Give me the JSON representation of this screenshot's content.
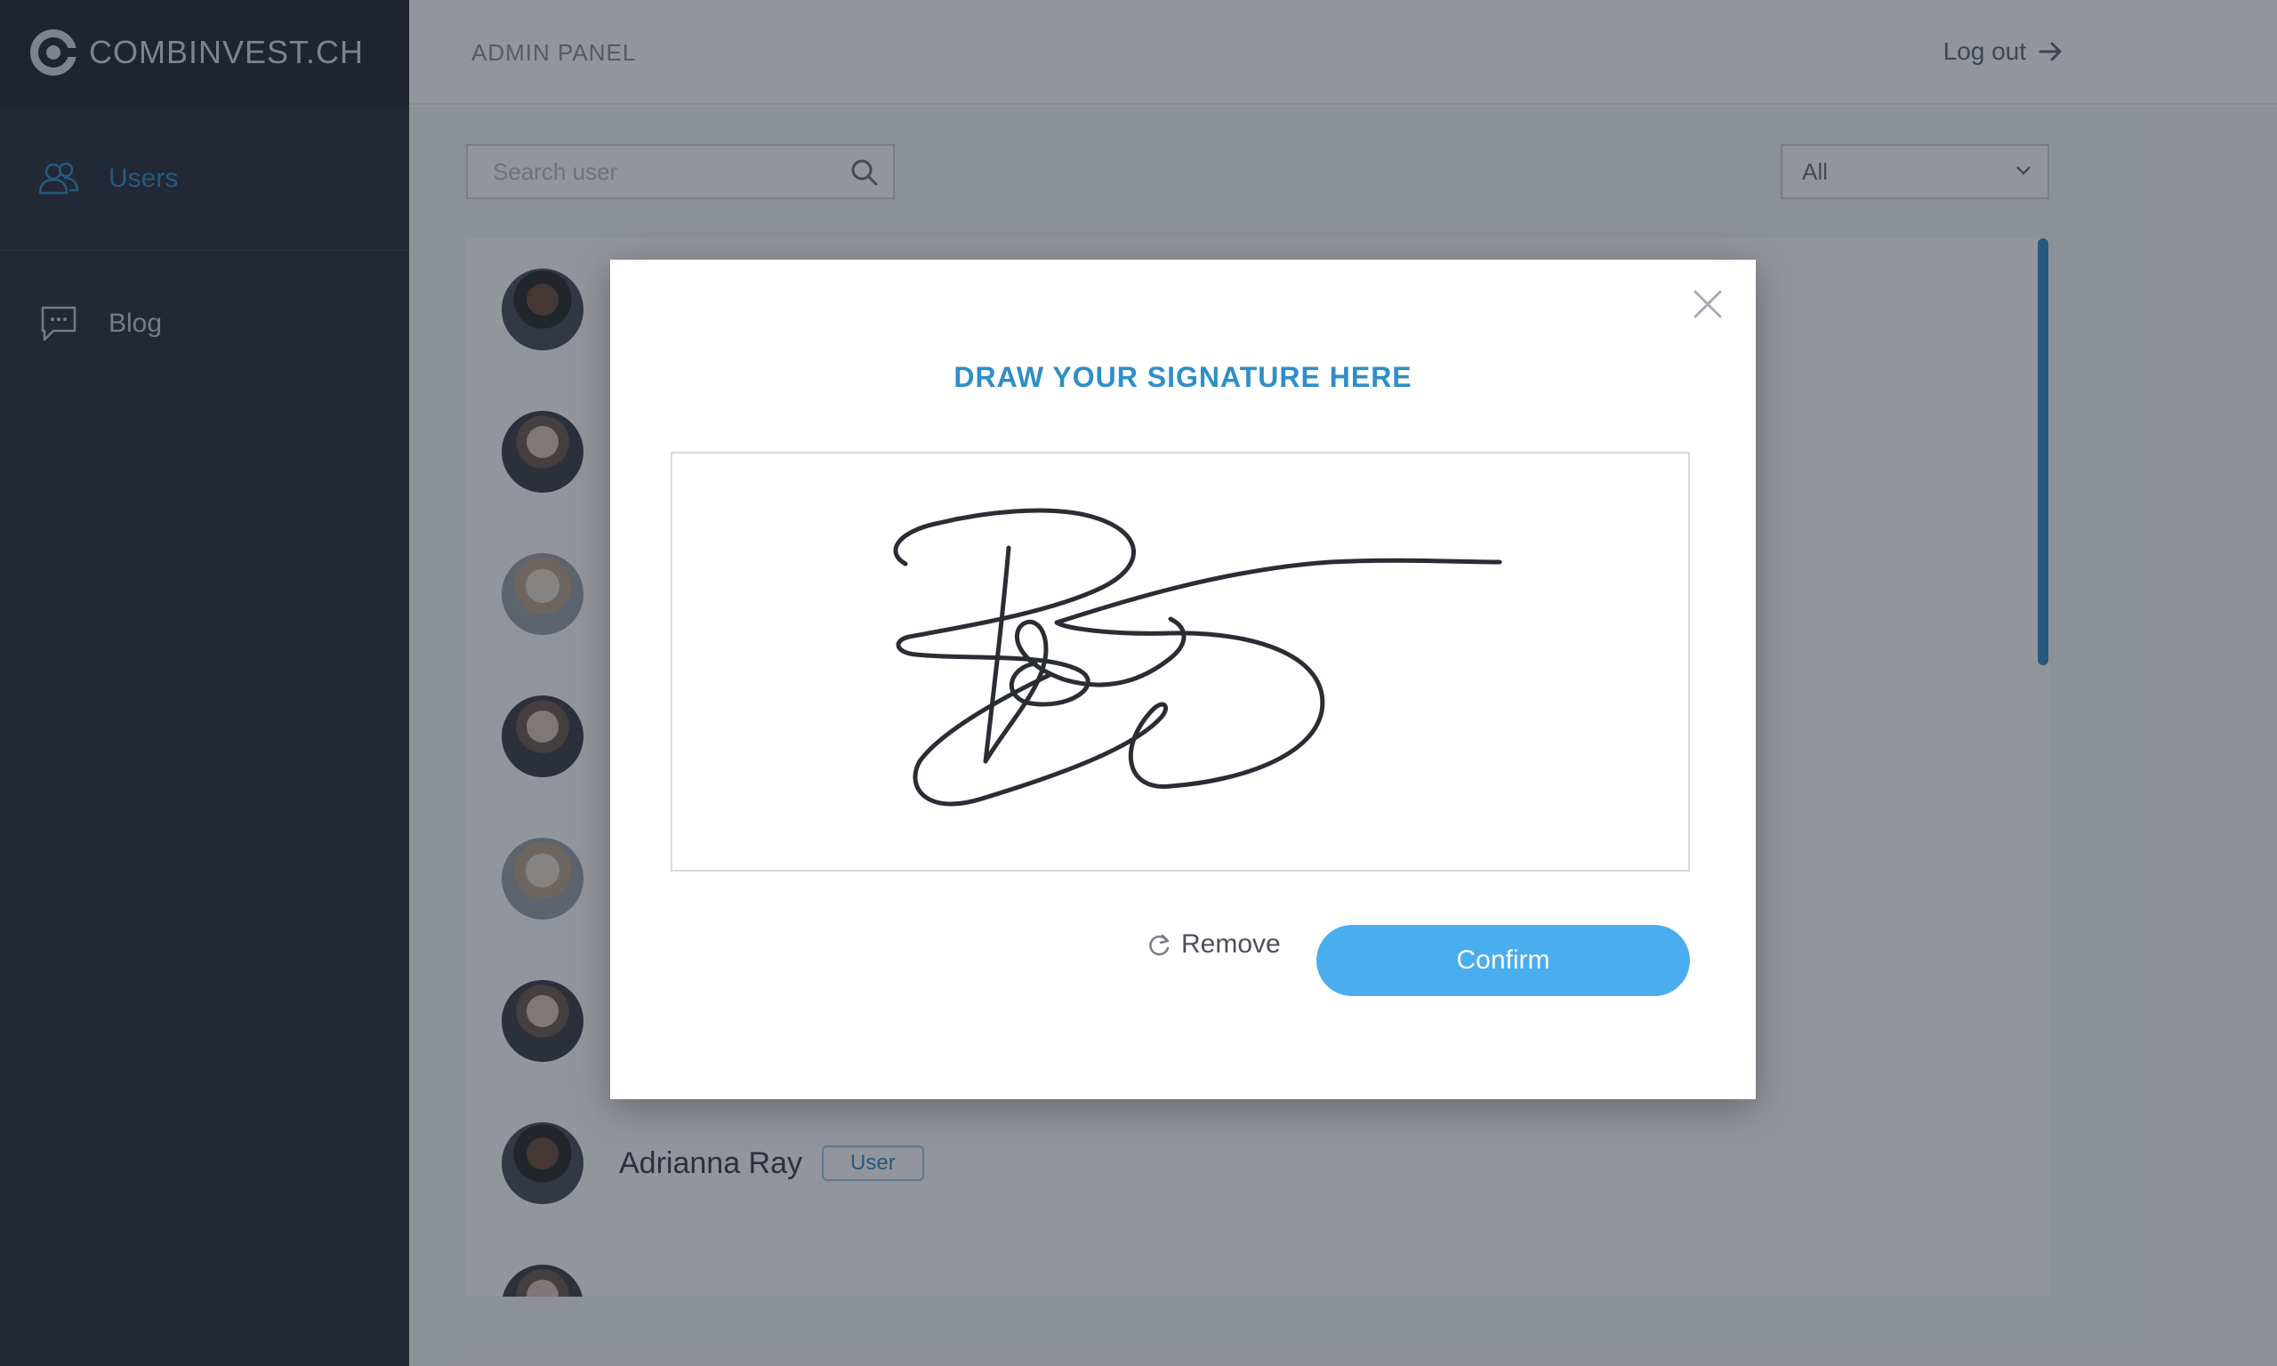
{
  "app": {
    "logo_text": "COMBINVEST.CH"
  },
  "sidebar": {
    "items": [
      {
        "label": "Users",
        "icon": "users-icon",
        "active": true
      },
      {
        "label": "Blog",
        "icon": "chat-icon",
        "active": false
      }
    ]
  },
  "header": {
    "title": "ADMIN PANEL",
    "logout_label": "Log out"
  },
  "toolbar": {
    "search_placeholder": "Search user",
    "filter_value": "All"
  },
  "users": [
    {
      "name": "Adrianna Ray",
      "role": "User"
    }
  ],
  "modal": {
    "title": "DRAW YOUR SIGNATURE HERE",
    "remove_label": "Remove",
    "confirm_label": "Confirm"
  },
  "colors": {
    "accent": "#2f8ec8",
    "confirm": "#4aaeee",
    "sidebar": "#2a2f3c"
  }
}
